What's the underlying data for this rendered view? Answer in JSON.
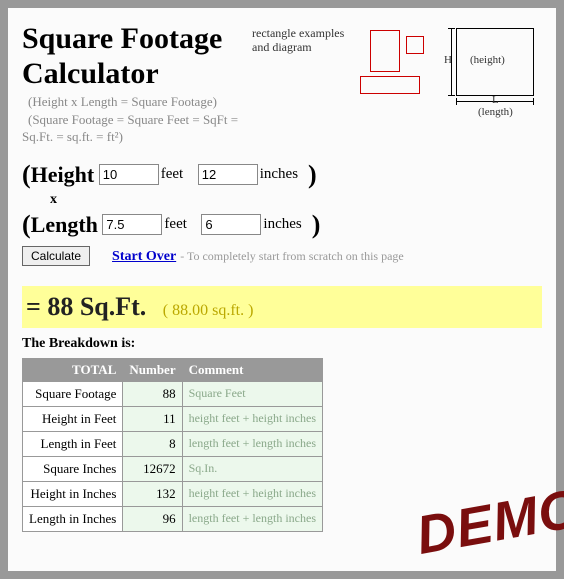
{
  "title": "Square Footage Calculator",
  "subtitle": {
    "line1": "(Height x Length = Square Footage)",
    "line2": "(Square Footage = Square Feet = SqFt =",
    "line3": "Sq.Ft. = sq.ft. = ft²)"
  },
  "diagram": {
    "caption_l1": "rectangle examples",
    "caption_l2": "and diagram",
    "h_label": "H",
    "height_label": "(height)",
    "l_label": "L",
    "length_label": "(length)"
  },
  "form": {
    "height_label": "Height",
    "length_label": "Length",
    "feet_unit": "feet",
    "inches_unit": "inches",
    "times": "x",
    "height_feet": "10",
    "height_inches": "12",
    "length_feet": "7.5",
    "length_inches": "6",
    "calculate": "Calculate",
    "start_over": "Start Over",
    "start_over_note": " - To completely start from scratch on this page"
  },
  "result": {
    "main": "= 88 Sq.Ft.",
    "sub": "( 88.00 sq.ft. )"
  },
  "breakdown": {
    "title": "The Breakdown is:",
    "headers": {
      "total": "TOTAL",
      "number": "Number",
      "comment": "Comment"
    },
    "rows": [
      {
        "label": "Square Footage",
        "number": "88",
        "comment": "Square Feet"
      },
      {
        "label": "Height in Feet",
        "number": "11",
        "comment": "height feet + height inches"
      },
      {
        "label": "Length in Feet",
        "number": "8",
        "comment": "length feet + length inches"
      },
      {
        "label": "Square Inches",
        "number": "12672",
        "comment": "Sq.In."
      },
      {
        "label": "Height in Inches",
        "number": "132",
        "comment": "height feet + height inches"
      },
      {
        "label": "Length in Inches",
        "number": "96",
        "comment": "length feet + length inches"
      }
    ]
  },
  "watermark": "DEMO"
}
